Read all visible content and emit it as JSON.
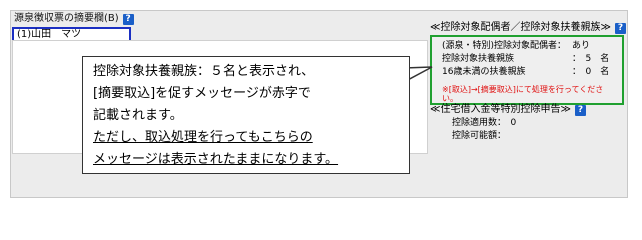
{
  "left": {
    "label": "源泉徴収票の摘要欄(B)",
    "help": "?",
    "memo_value": "(1)山田　マツ"
  },
  "right": {
    "title": "≪控除対象配偶者／控除対象扶養親族≫",
    "help": "?",
    "rows": [
      {
        "label": "(源泉・特別)控除対象配偶者：",
        "value": "あり"
      },
      {
        "label": "控除対象扶養親族",
        "value": "：　5　名"
      },
      {
        "label": "16歳未満の扶養親族",
        "value": "：　0　名"
      }
    ],
    "note": "※[取込]→[摘要取込]にて処理を行ってください。",
    "title2": "≪住宅借入金等特別控除申告≫",
    "help2": "?",
    "apply_rows": [
      {
        "text": "控除適用数：　0"
      },
      {
        "text": "控除可能額："
      }
    ]
  },
  "callout": {
    "lines": [
      "控除対象扶養親族：５名と表示され、",
      "[摘要取込]を促すメッセージが赤字で",
      "記載されます。",
      "ただし、取込処理を行ってもこちらの",
      "メッセージは表示されたままになります。"
    ]
  },
  "colors": {
    "memo_border": "#1b2fc2",
    "highlight_border": "#20a030",
    "note_text": "#e01010",
    "help_icon": "#1a5fc8"
  }
}
